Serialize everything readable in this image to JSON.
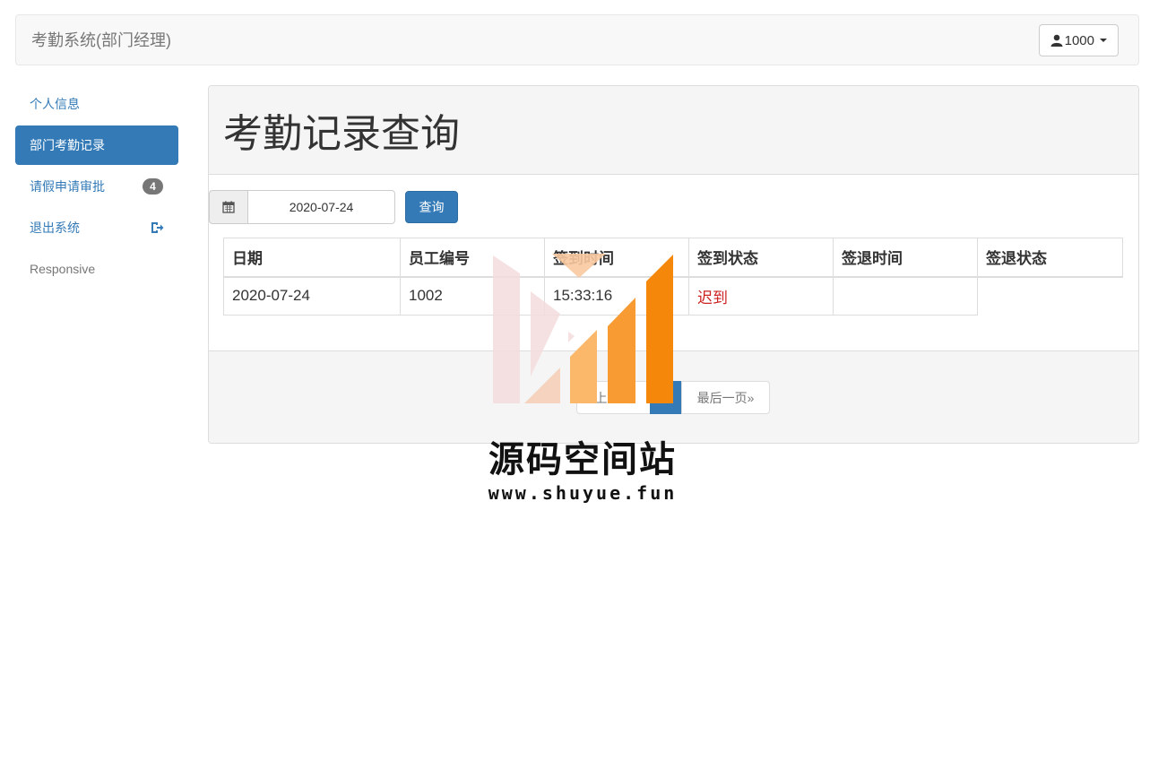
{
  "navbar": {
    "brand": "考勤系统(部门经理)",
    "user_label": "1000"
  },
  "sidebar": {
    "items": [
      {
        "label": "个人信息"
      },
      {
        "label": "部门考勤记录"
      },
      {
        "label": "请假申请审批",
        "badge": "4"
      },
      {
        "label": "退出系统"
      },
      {
        "label": "Responsive"
      }
    ]
  },
  "main": {
    "title": "考勤记录查询",
    "date_value": "2020-07-24",
    "query_label": "查询",
    "table": {
      "headers": [
        "日期",
        "员工编号",
        "签到时间",
        "签到状态",
        "签退时间",
        "签退状态"
      ],
      "rows": [
        [
          "2020-07-24",
          "1002",
          "15:33:16",
          "迟到",
          "",
          ""
        ]
      ]
    },
    "pager": {
      "prev_label": "上一页",
      "current_label": "",
      "last_label": "最后一页»"
    }
  },
  "watermark": {
    "name": "源码空间站",
    "url": "www.shuyue.fun"
  },
  "colors": {
    "primary": "#337ab7",
    "late": "#cc2222",
    "badge": "#777777"
  }
}
